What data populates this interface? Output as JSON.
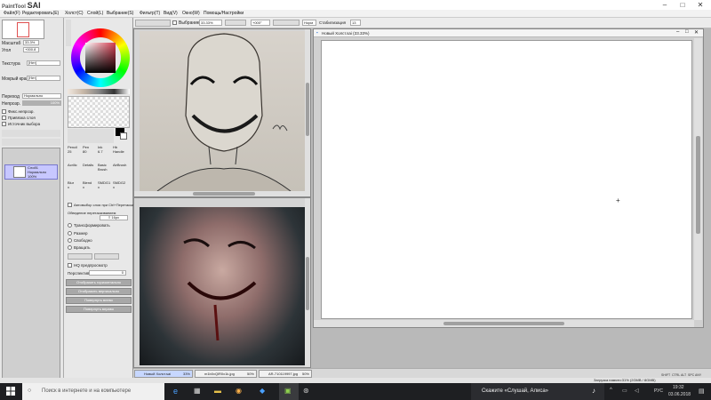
{
  "app": {
    "logo_small": "PaintTool",
    "logo_big": "SAI",
    "window_controls": [
      "–",
      "□",
      "✕"
    ]
  },
  "menu": [
    "Файл(F)",
    "Редактировать(E)",
    "Холст(C)",
    "Слой(L)",
    "Выбрание(S)",
    "Фильтр(T)",
    "Вид(V)",
    "Окно(W)",
    "Помощь/Настройки"
  ],
  "toolbar": {
    "selection_label": "Выбрание",
    "zoom_value": "33.33%",
    "angle_value": "+000°",
    "norm_label": "Норм",
    "stabilizer_label": "Стабилизация",
    "stabilizer_value": "13"
  },
  "left": {
    "zoom_label": "Масштаб",
    "zoom_value": "33.3%",
    "angle_label": "Угол",
    "angle_value": "+000.8",
    "texture_label": "Текстура",
    "texture_value": "[Нет]",
    "effect_label": "Мокрый край",
    "effect_value": "[Нет]",
    "blend_label": "Переход",
    "blend_value": "Нормально",
    "opacity_label": "Непрозр.",
    "opacity_value": "100%",
    "checkboxes": [
      "Фикс.непрозр.",
      "Привязка слоя",
      "Источник выбора"
    ],
    "layer_name": "Слой1",
    "layer_mode": "Нормально",
    "layer_opacity": "100%"
  },
  "tools": {
    "brushes": [
      {
        "name": "Pencil",
        "size": "25"
      },
      {
        "name": "Pen",
        "size": "80"
      },
      {
        "name": "Ink",
        "size": "6.7"
      },
      {
        "name": "Hb",
        "size": "Handle"
      },
      {
        "name": "Acrilic",
        "size": ""
      },
      {
        "name": "Details",
        "size": ""
      },
      {
        "name": "Basic",
        "size": "Brush"
      },
      {
        "name": "AirBrush",
        "size": ""
      },
      {
        "name": "Blur",
        "size": "x"
      },
      {
        "name": "Blend",
        "size": "x"
      },
      {
        "name": "SMDG1",
        "size": "x"
      },
      {
        "name": "SMDG2",
        "size": "x"
      }
    ],
    "auto_select_label": "Автовыбор слоя при Ctrl+Перетаскив.",
    "snap_label": "Обведение перетаскиванием",
    "snap_value": "≡ 16px",
    "radios": [
      "Трансформировать",
      "Размер",
      "Свободно",
      "Вращать"
    ],
    "hq_label": "HQ предпросмотр",
    "perspective_label": "Перспектива",
    "perspective_value": "0",
    "buttons": [
      "Отобразить горизонтально",
      "Отобразить вертикально",
      "Повернуть влево",
      "Повернуть вправо"
    ]
  },
  "canvas_main": {
    "title": "Новый Холст.sai (33.33%)"
  },
  "doc_tabs": [
    {
      "name": "Новый Холст.sai",
      "zoom": "33%"
    },
    {
      "name": "m1b0vQlR0x1k.jpg",
      "zoom": "50%"
    },
    {
      "name": "AR-710119997.jpg",
      "zoom": "50%"
    }
  ],
  "status": {
    "memory": "Загрузка памяти:31% (2GMB / 8GMB)",
    "keys": [
      "SHIFT",
      "CTRL",
      "ALT",
      "SPC",
      "ANY"
    ]
  },
  "taskbar": {
    "search_placeholder": "Поиск в интернете и на компьютере",
    "alice_text": "Скажите «Слушай, Алиса»",
    "lang": "РУС",
    "time": "19:32",
    "date": "03.06.2018"
  },
  "colors": {
    "accent": "#2a6fd6",
    "canvas_bg": "#ffffff",
    "selected_layer": "#c7c7ff"
  }
}
